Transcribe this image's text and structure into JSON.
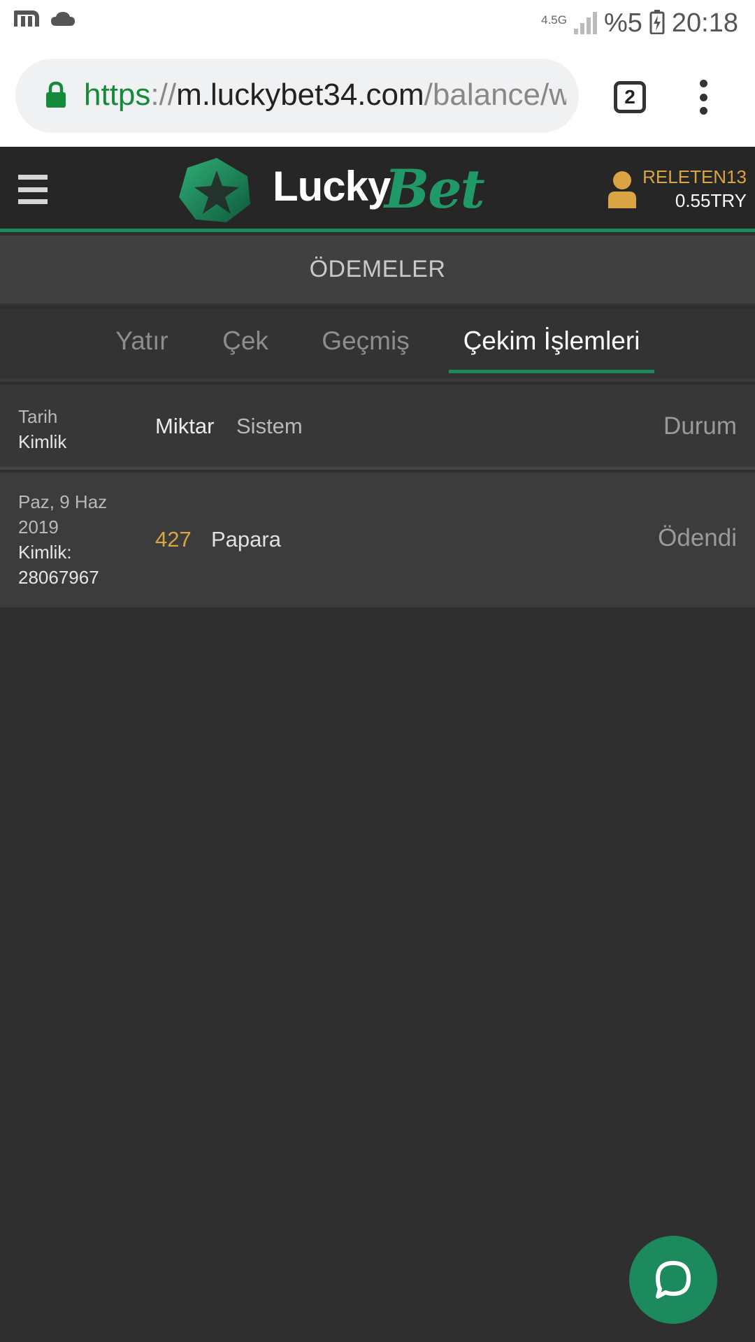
{
  "status_bar": {
    "network_label": "4.5G",
    "battery_text": "%5",
    "clock": "20:18",
    "left_icons": [
      "m-app-icon",
      "cloud-icon"
    ],
    "right_icons": [
      "data-arrows-icon",
      "signal-icon",
      "battery-charging-icon"
    ]
  },
  "browser": {
    "url_scheme": "https",
    "url_separator": "://",
    "url_host": "m.luckybet34.com",
    "url_path": "/balance/w",
    "tab_count": "2",
    "secure_color": "#148a3a"
  },
  "header": {
    "brand_part1": "Lucky",
    "brand_part2": "Bet",
    "username": "RELETEN13",
    "balance": "0.55TRY",
    "accent_color": "#1c8a5c",
    "username_color": "#d9a441"
  },
  "section": {
    "title": "ÖDEMELER"
  },
  "tabs": [
    {
      "label": "Yatır",
      "active": false
    },
    {
      "label": "Çek",
      "active": false
    },
    {
      "label": "Geçmiş",
      "active": false
    },
    {
      "label": "Çekim İşlemleri",
      "active": true
    }
  ],
  "table": {
    "headers": {
      "date": "Tarih",
      "id": "Kimlik",
      "amount": "Miktar",
      "system": "Sistem",
      "status": "Durum"
    },
    "rows": [
      {
        "date_line1": "Paz, 9 Haz",
        "date_line2": "2019",
        "id_label": "Kimlik:",
        "id_value": "28067967",
        "amount": "427",
        "system": "Papara",
        "status": "Ödendi"
      }
    ]
  },
  "chat": {
    "icon": "chat-bubble-icon"
  }
}
